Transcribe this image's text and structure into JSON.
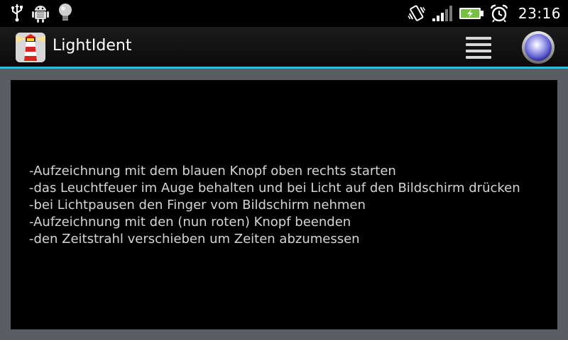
{
  "status_bar": {
    "time": "23:16",
    "icons": [
      "usb-icon",
      "android-debug-icon",
      "lightbulb-icon",
      "vibrate-icon",
      "signal-icon",
      "battery-charging-icon",
      "alarm-icon"
    ]
  },
  "action_bar": {
    "title": "LightIdent",
    "app_icon": "lighthouse-icon",
    "accent_color": "#33b5e5"
  },
  "instructions": [
    "-Aufzeichnung mit dem blauen Knopf oben rechts starten",
    "-das Leuchtfeuer im Auge behalten und bei Licht auf den Bildschirm drücken",
    "-bei Lichtpausen den Finger vom Bildschirm nehmen",
    "-Aufzeichnung mit den (nun roten) Knopf beenden",
    "-den Zeitstrahl verschieben um Zeiten abzumessen"
  ]
}
